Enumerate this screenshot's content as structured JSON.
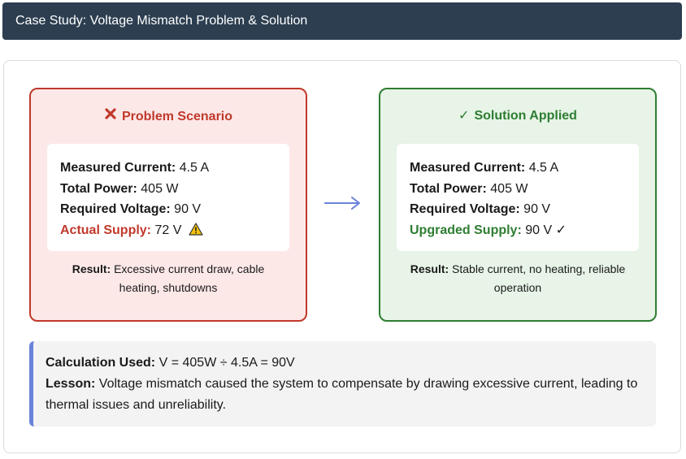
{
  "header": {
    "title": "Case Study: Voltage Mismatch Problem & Solution"
  },
  "problem": {
    "title": "Problem Scenario",
    "title_icon": "cross-mark-icon",
    "rows": [
      {
        "label": "Measured Current:",
        "value": "4.5 A"
      },
      {
        "label": "Total Power:",
        "value": "405 W"
      },
      {
        "label": "Required Voltage:",
        "value": "90 V"
      },
      {
        "label": "Actual Supply:",
        "value": "72 V",
        "icon": "warning-icon"
      }
    ],
    "result_label": "Result:",
    "result_text": "Excessive current draw, cable heating, shutdowns"
  },
  "solution": {
    "title_icon": "✓",
    "title": "Solution Applied",
    "rows": [
      {
        "label": "Measured Current:",
        "value": "4.5 A"
      },
      {
        "label": "Total Power:",
        "value": "405 W"
      },
      {
        "label": "Required Voltage:",
        "value": "90 V"
      },
      {
        "label": "Upgraded Supply:",
        "value": "90 V ✓"
      }
    ],
    "result_label": "Result:",
    "result_text": "Stable current, no heating, reliable operation"
  },
  "arrow_icon": "right-arrow-icon",
  "summary": {
    "calc_label": "Calculation Used:",
    "calc_text": "V = 405W ÷ 4.5A = 90V",
    "lesson_label": "Lesson:",
    "lesson_text": "Voltage mismatch caused the system to compensate by drawing excessive current, leading to thermal issues and unreliability."
  },
  "colors": {
    "header_bg": "#2c3e50",
    "problem_accent": "#c0392b",
    "problem_bg": "#fde8e8",
    "solution_accent": "#2e7d32",
    "solution_bg": "#e7f4e7",
    "arrow": "#6a82d8",
    "summary_border": "#6a82d8"
  }
}
